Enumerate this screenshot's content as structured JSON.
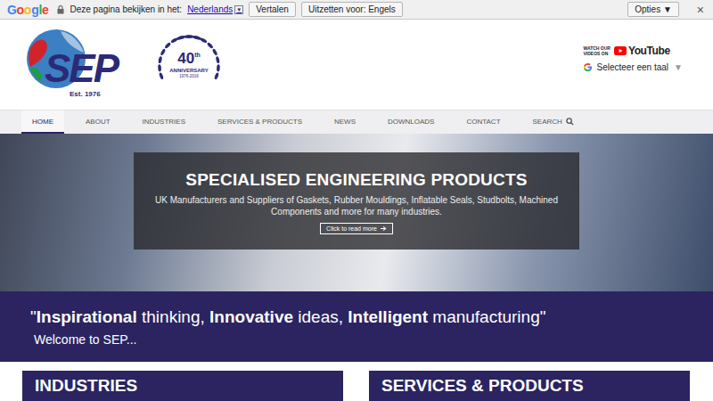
{
  "translate_bar": {
    "brand": "Google",
    "prompt": "Deze pagina bekijken in het:",
    "language": "Nederlands",
    "language_arrow": "▼",
    "buttons": [
      "Vertalen",
      "Uitzetten voor: Engels"
    ],
    "options": "Opties ▼",
    "close": "×"
  },
  "header": {
    "logo": {
      "text": "SEP",
      "established": "Est. 1976"
    },
    "anniversary": {
      "number": "40",
      "suffix": "th",
      "label": "ANNIVERSARY",
      "years": "1976-2016"
    },
    "youtube": {
      "lines": [
        "WATCH OUR",
        "VIDEOS ON"
      ],
      "brand": "YouTube"
    },
    "language_select": {
      "label": "Selecteer een taal",
      "arrow": "▼"
    }
  },
  "nav": {
    "items": [
      {
        "label": "HOME",
        "selected": true
      },
      {
        "label": "ABOUT",
        "selected": false
      },
      {
        "label": "INDUSTRIES",
        "selected": false
      },
      {
        "label": "SERVICES & PRODUCTS",
        "selected": false
      },
      {
        "label": "NEWS",
        "selected": false
      },
      {
        "label": "DOWNLOADS",
        "selected": false
      },
      {
        "label": "CONTACT",
        "selected": false
      },
      {
        "label": "SEARCH",
        "selected": false
      }
    ]
  },
  "hero": {
    "title": "SPECIALISED ENGINEERING PRODUCTS",
    "subtitle": "UK Manufacturers and Suppliers of Gaskets, Rubber Mouldings, Inflatable Seals, Studbolts, Machined Components and more for many industries.",
    "button": "Click to read more"
  },
  "banner": {
    "quote": [
      {
        "text": "\"",
        "bold": false
      },
      {
        "text": "Inspirational",
        "bold": true
      },
      {
        "text": " thinking, ",
        "bold": false
      },
      {
        "text": "Innovative",
        "bold": true
      },
      {
        "text": " ideas, ",
        "bold": false
      },
      {
        "text": "Intelligent",
        "bold": true
      },
      {
        "text": " manufacturing\"",
        "bold": false
      }
    ],
    "welcome": "Welcome to SEP..."
  },
  "sections": [
    {
      "title": "INDUSTRIES"
    },
    {
      "title": "SERVICES & PRODUCTS"
    }
  ]
}
